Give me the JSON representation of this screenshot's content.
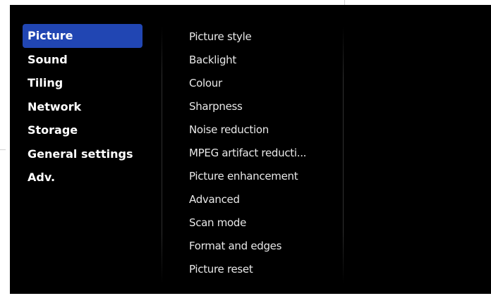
{
  "main_menu": {
    "items": [
      {
        "label": "Picture"
      },
      {
        "label": "Sound"
      },
      {
        "label": "Tiling"
      },
      {
        "label": "Network"
      },
      {
        "label": "Storage"
      },
      {
        "label": "General settings"
      },
      {
        "label": "Adv."
      }
    ],
    "selected": "Picture"
  },
  "sub_menu": {
    "items": [
      {
        "label": "Picture style"
      },
      {
        "label": "Backlight"
      },
      {
        "label": "Colour"
      },
      {
        "label": "Sharpness"
      },
      {
        "label": "Noise reduction"
      },
      {
        "label": "MPEG artifact reducti..."
      },
      {
        "label": "Picture enhancement"
      },
      {
        "label": "Advanced"
      },
      {
        "label": "Scan mode"
      },
      {
        "label": "Format and edges"
      },
      {
        "label": "Picture reset"
      }
    ]
  },
  "colors": {
    "background": "#000000",
    "selection": "#2146b3",
    "text": "#ffffff"
  }
}
